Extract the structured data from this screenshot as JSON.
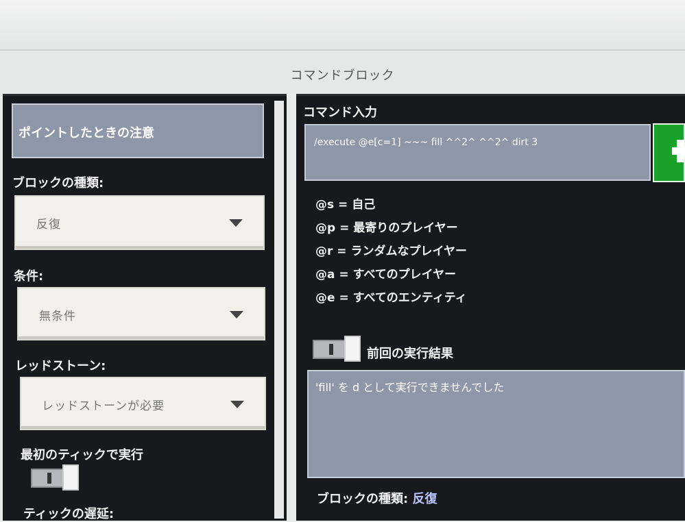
{
  "window": {
    "title": "コマンドブロック"
  },
  "left": {
    "hover_note_label": "ポイントしたときの注意",
    "block_type": {
      "label": "ブロックの種類:",
      "value": "反復"
    },
    "condition": {
      "label": "条件:",
      "value": "無条件"
    },
    "redstone": {
      "label": "レッドストーン:",
      "value": "レッドストーンが必要"
    },
    "execute_first_tick": {
      "label": "最初のティックで実行",
      "on": true
    },
    "tick_delay": {
      "label": "ティックの遅延:"
    }
  },
  "right": {
    "command_input": {
      "label": "コマンド入力",
      "value": "/execute @e[c=1] ~~~ fill ^^2^ ^^2^ dirt 3",
      "add_icon": "plus-icon"
    },
    "selectors": [
      "@s = 自己",
      "@p = 最寄りのプレイヤー",
      "@r = ランダムなプレイヤー",
      "@a = すべてのプレイヤー",
      "@e = すべてのエンティティ"
    ],
    "previous_output": {
      "label": "前回の実行結果",
      "on": false,
      "value": "'fill' を d として実行できませんでした"
    },
    "footer": {
      "block_type_label": "ブロックの種類:",
      "block_type_value": "反復"
    }
  }
}
